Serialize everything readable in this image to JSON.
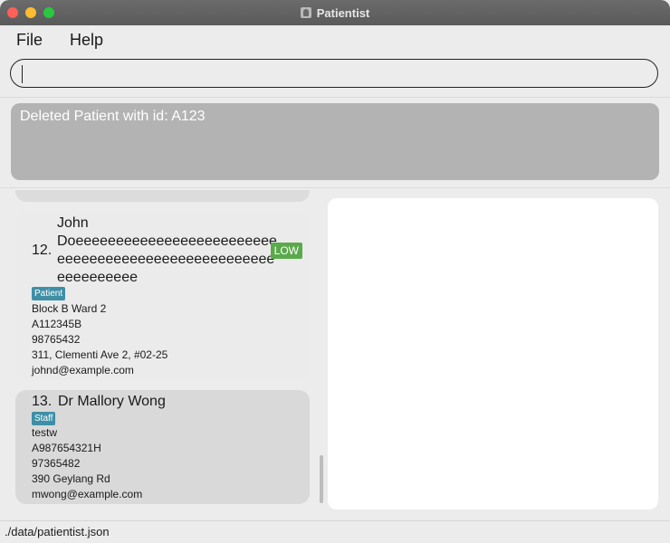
{
  "window": {
    "title": "Patientist"
  },
  "menu": {
    "file": "File",
    "help": "Help"
  },
  "command": {
    "value": "",
    "placeholder": ""
  },
  "result": {
    "message": "Deleted Patient with id: A123"
  },
  "list": {
    "items": [
      {
        "index": "12.",
        "name_line1": "John",
        "name_line2": "Doeeeeeeeeeeeeeeeeeeeeeeeee",
        "name_line3": "eeeeeeeeeeeeeeeeeeeeeeeeeee",
        "name_line4": "eeeeeeeeee",
        "priority": "LOW",
        "tag": "Patient",
        "ward": "Block B Ward 2",
        "id": "A112345B",
        "phone": "98765432",
        "address": "311, Clementi Ave 2, #02-25",
        "email": "johnd@example.com"
      },
      {
        "index": "13.",
        "name": "Dr Mallory Wong",
        "tag": "Staff",
        "ward": "testw",
        "id": "A987654321H",
        "phone": "97365482",
        "address": "390 Geylang Rd",
        "email": "mwong@example.com"
      }
    ]
  },
  "status": {
    "path": "./data/patientist.json"
  },
  "colors": {
    "priority_low": "#5aaa4b",
    "tag": "#3e8fa6",
    "result_bg": "#b3b3b3"
  },
  "icons": {
    "app": "person-badge-icon"
  }
}
